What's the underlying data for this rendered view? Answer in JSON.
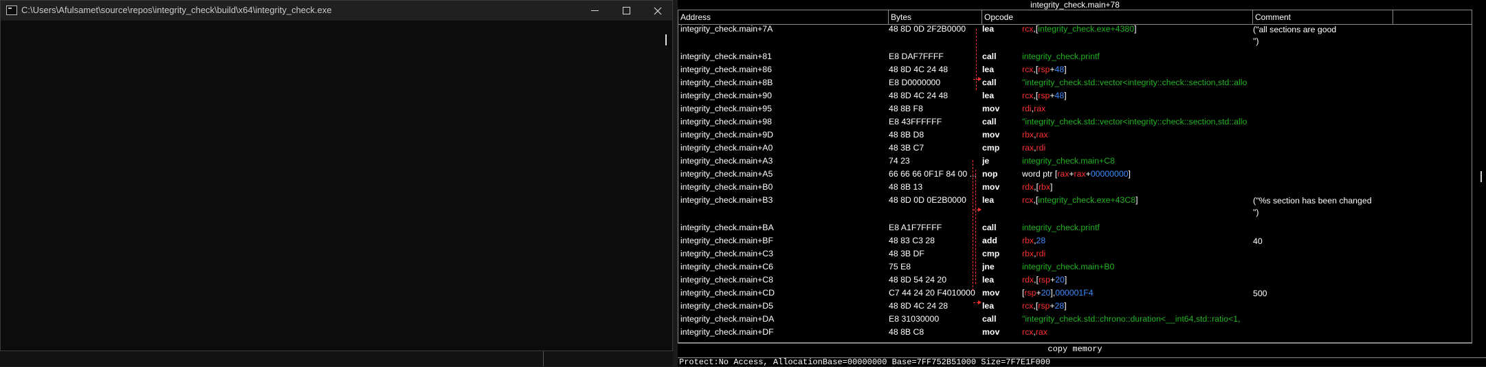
{
  "console": {
    "title": "C:\\Users\\Afulsamet\\source\\repos\\integrity_check\\build\\x64\\integrity_check.exe"
  },
  "debugger": {
    "title": "integrity_check.main+78",
    "columns": [
      "Address",
      "Bytes",
      "Opcode",
      "Comment"
    ],
    "copy_button": "copy memory",
    "status_text": "Protect:No Access, AllocationBase=00000000 Base=7FF752B51000 Size=7F7E1F000",
    "rows": [
      {
        "addr": "integrity_check.main+7A",
        "bytes": "48 8D 0D 2F2B0000",
        "mn": "lea",
        "op": [
          [
            "rcx",
            "r"
          ],
          [
            ",[",
            "w"
          ],
          [
            "integrity_check.exe+4380",
            "g"
          ],
          [
            "]",
            "w"
          ]
        ],
        "comment": "(\"all sections are good\n\")"
      },
      {
        "addr": "integrity_check.main+81",
        "bytes": "E8 DAF7FFFF",
        "mn": "call",
        "op": [
          [
            "integrity_check.printf",
            "g"
          ]
        ],
        "comment": ""
      },
      {
        "addr": "integrity_check.main+86",
        "bytes": "48 8D 4C 24 48",
        "mn": "lea",
        "op": [
          [
            "rcx",
            "r"
          ],
          [
            ",[",
            "w"
          ],
          [
            "rsp",
            "r"
          ],
          [
            "+",
            "w"
          ],
          [
            "48",
            "b"
          ],
          [
            "]",
            "w"
          ]
        ],
        "comment": ""
      },
      {
        "addr": "integrity_check.main+8B",
        "bytes": "E8 D0000000",
        "mn": "call",
        "op": [
          [
            "\"integrity_check.std::vector<integrity::check::section,std::allo",
            "g"
          ]
        ],
        "comment": ""
      },
      {
        "addr": "integrity_check.main+90",
        "bytes": "48 8D 4C 24 48",
        "mn": "lea",
        "op": [
          [
            "rcx",
            "r"
          ],
          [
            ",[",
            "w"
          ],
          [
            "rsp",
            "r"
          ],
          [
            "+",
            "w"
          ],
          [
            "48",
            "b"
          ],
          [
            "]",
            "w"
          ]
        ],
        "comment": ""
      },
      {
        "addr": "integrity_check.main+95",
        "bytes": "48 8B F8",
        "mn": "mov",
        "op": [
          [
            "rdi",
            "r"
          ],
          [
            ",",
            "w"
          ],
          [
            "rax",
            "r"
          ]
        ],
        "comment": ""
      },
      {
        "addr": "integrity_check.main+98",
        "bytes": "E8 43FFFFFF",
        "mn": "call",
        "op": [
          [
            "\"integrity_check.std::vector<integrity::check::section,std::allo",
            "g"
          ]
        ],
        "comment": ""
      },
      {
        "addr": "integrity_check.main+9D",
        "bytes": "48 8B D8",
        "mn": "mov",
        "op": [
          [
            "rbx",
            "r"
          ],
          [
            ",",
            "w"
          ],
          [
            "rax",
            "r"
          ]
        ],
        "comment": ""
      },
      {
        "addr": "integrity_check.main+A0",
        "bytes": "48 3B C7",
        "mn": "cmp",
        "op": [
          [
            "rax",
            "r"
          ],
          [
            ",",
            "w"
          ],
          [
            "rdi",
            "r"
          ]
        ],
        "comment": ""
      },
      {
        "addr": "integrity_check.main+A3",
        "bytes": "74 23",
        "mn": "je",
        "op": [
          [
            "integrity_check.main+C8",
            "g"
          ]
        ],
        "comment": ""
      },
      {
        "addr": "integrity_check.main+A5",
        "bytes": "66 66 66 0F1F 84 00 ...",
        "mn": "nop",
        "op": [
          [
            "word ptr [",
            "w"
          ],
          [
            "rax",
            "r"
          ],
          [
            "+",
            "w"
          ],
          [
            "rax",
            "r"
          ],
          [
            "+",
            "w"
          ],
          [
            "00000000",
            "b"
          ],
          [
            "]",
            "w"
          ]
        ],
        "comment": ""
      },
      {
        "addr": "integrity_check.main+B0",
        "bytes": "48 8B 13",
        "mn": "mov",
        "op": [
          [
            "rdx",
            "r"
          ],
          [
            ",[",
            "w"
          ],
          [
            "rbx",
            "r"
          ],
          [
            "]",
            "w"
          ]
        ],
        "comment": ""
      },
      {
        "addr": "integrity_check.main+B3",
        "bytes": "48 8D 0D 0E2B0000",
        "mn": "lea",
        "op": [
          [
            "rcx",
            "r"
          ],
          [
            ",[",
            "w"
          ],
          [
            "integrity_check.exe+43C8",
            "g"
          ],
          [
            "]",
            "w"
          ]
        ],
        "comment": "(\"%s section has been changed\n\")"
      },
      {
        "addr": "integrity_check.main+BA",
        "bytes": "E8 A1F7FFFF",
        "mn": "call",
        "op": [
          [
            "integrity_check.printf",
            "g"
          ]
        ],
        "comment": ""
      },
      {
        "addr": "integrity_check.main+BF",
        "bytes": "48 83 C3 28",
        "mn": "add",
        "op": [
          [
            "rbx",
            "r"
          ],
          [
            ",",
            "w"
          ],
          [
            "28",
            "b"
          ]
        ],
        "comment": "40"
      },
      {
        "addr": "integrity_check.main+C3",
        "bytes": "48 3B DF",
        "mn": "cmp",
        "op": [
          [
            "rbx",
            "r"
          ],
          [
            ",",
            "w"
          ],
          [
            "rdi",
            "r"
          ]
        ],
        "comment": ""
      },
      {
        "addr": "integrity_check.main+C6",
        "bytes": "75 E8",
        "mn": "jne",
        "op": [
          [
            "integrity_check.main+B0",
            "g"
          ]
        ],
        "comment": ""
      },
      {
        "addr": "integrity_check.main+C8",
        "bytes": "48 8D 54 24 20",
        "mn": "lea",
        "op": [
          [
            "rdx",
            "r"
          ],
          [
            ",[",
            "w"
          ],
          [
            "rsp",
            "r"
          ],
          [
            "+",
            "w"
          ],
          [
            "20",
            "b"
          ],
          [
            "]",
            "w"
          ]
        ],
        "comment": ""
      },
      {
        "addr": "integrity_check.main+CD",
        "bytes": "C7 44 24 20 F4010000",
        "mn": "mov",
        "op": [
          [
            "[",
            "w"
          ],
          [
            "rsp",
            "r"
          ],
          [
            "+",
            "w"
          ],
          [
            "20",
            "b"
          ],
          [
            "],",
            "w"
          ],
          [
            "000001F4",
            "b"
          ]
        ],
        "comment": "500"
      },
      {
        "addr": "integrity_check.main+D5",
        "bytes": "48 8D 4C 24 28",
        "mn": "lea",
        "op": [
          [
            "rcx",
            "r"
          ],
          [
            ",[",
            "w"
          ],
          [
            "rsp",
            "r"
          ],
          [
            "+",
            "w"
          ],
          [
            "28",
            "b"
          ],
          [
            "]",
            "w"
          ]
        ],
        "comment": ""
      },
      {
        "addr": "integrity_check.main+DA",
        "bytes": "E8 31030000",
        "mn": "call",
        "op": [
          [
            "\"integrity_check.std::chrono::duration<__int64,std::ratio<1,",
            "g"
          ]
        ],
        "comment": ""
      },
      {
        "addr": "integrity_check.main+DF",
        "bytes": "48 8B C8",
        "mn": "mov",
        "op": [
          [
            "rcx",
            "r"
          ],
          [
            ",",
            "w"
          ],
          [
            "rax",
            "r"
          ]
        ],
        "comment": ""
      }
    ]
  }
}
